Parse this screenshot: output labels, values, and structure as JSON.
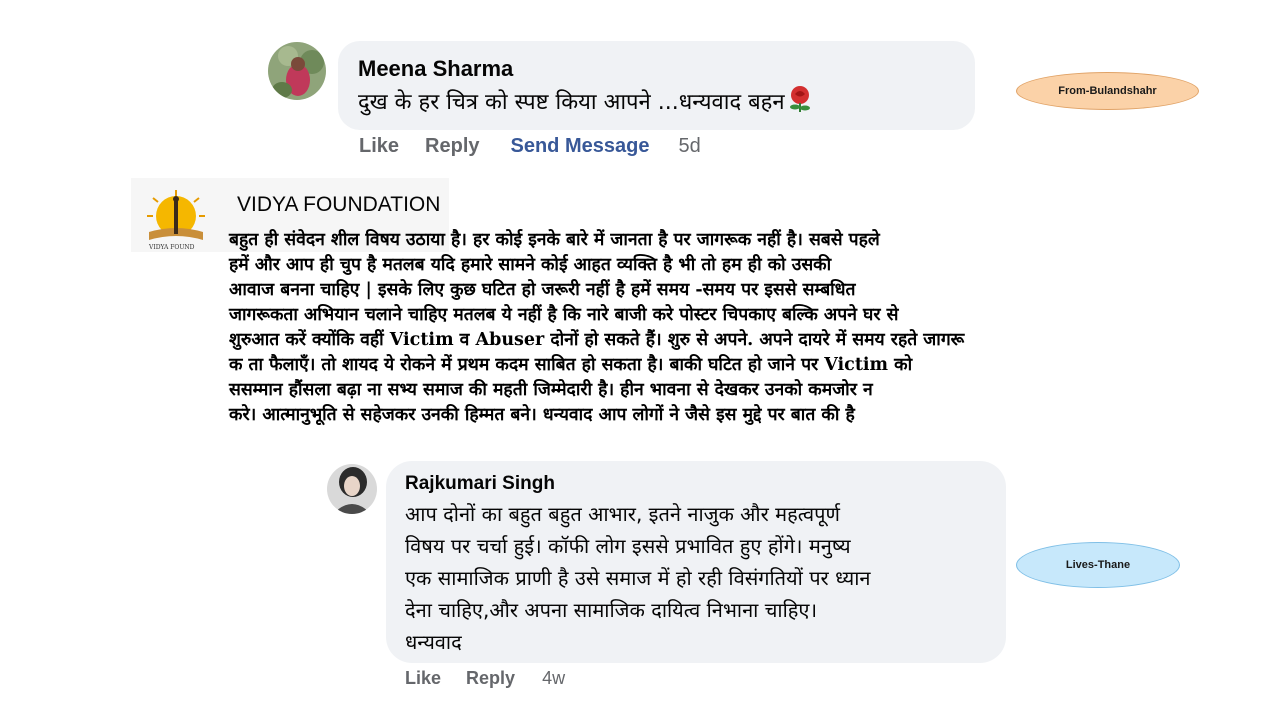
{
  "comment1": {
    "author": "Meena Sharma",
    "text": "दुख के हर चित्र को स्पष्ट किया आपने ...धन्यवाद बहन",
    "emoji_icon": "rose-icon",
    "actions": {
      "like": "Like",
      "reply": "Reply",
      "send_message": "Send Message",
      "timestamp": "5d"
    },
    "tag": "From-Bulandshahr"
  },
  "comment2": {
    "author": "VIDYA FOUNDATION",
    "logo_text": "VIDYA FOUND",
    "lines": [
      "बहुत ही संवेदन शील विषय उठाया है। हर कोई इनके बारे में जानता है पर जागरूक नहीं है। सबसे पहले",
      "हमें और आप ही चुप है मतलब यदि हमारे सामने कोई आहत व्यक्ति है भी तो हम ही को उसकी",
      "आवाज बनना चाहिए | इसके लिए कुछ घटित हो जरूरी नहीं है हमें समय -समय पर इससे सम्बधित",
      "जागरूकता अभियान चलाने चाहिए मतलब ये नहीं है कि नारे बाजी करे पोस्टर चिपकाए बल्कि अपने घर से",
      "शुरुआत करें क्योंकि वहीं Victim व Abuser दोनों हो सकते हैं। शुरु से अपने. अपने दायरे में समय रहते जागरू",
      "क ता फैलाएँ। तो शायद ये रोकने में प्रथम कदम साबित हो सकता है। बाकी घटित हो जाने पर Victim को",
      "ससम्मान हौंसला बढ़ा ना सभ्य समाज की महती जिम्मेदारी है। हीन भावना से देखकर उनको कमजोर न",
      "करे। आत्मानुभूति से सहेजकर उनकी हिम्मत बने। धन्यवाद आप लोगों ने जैसे इस मुद्दे पर बात की है"
    ]
  },
  "comment3": {
    "author": "Rajkumari Singh",
    "lines": [
      "आप दोनों का बहुत बहुत आभार, इतने नाजुक और महत्वपूर्ण",
      "विषय पर चर्चा हुई। कॉफी लोग इससे प्रभावित हुए होंगे। मनुष्य",
      "एक सामाजिक प्राणी है उसे समाज में हो रही विसंगतियों पर ध्यान",
      "देना चाहिए,और अपना सामाजिक दायित्व निभाना चाहिए।",
      "धन्यवाद"
    ],
    "actions": {
      "like": "Like",
      "reply": "Reply",
      "timestamp": "4w"
    },
    "tag": "Lives-Thane"
  },
  "colors": {
    "bubble_bg": "#f0f2f5",
    "action_gray": "#65676b",
    "link_blue": "#385898",
    "tag_orange": "#fbd2a8",
    "tag_blue": "#c7e8fb"
  }
}
